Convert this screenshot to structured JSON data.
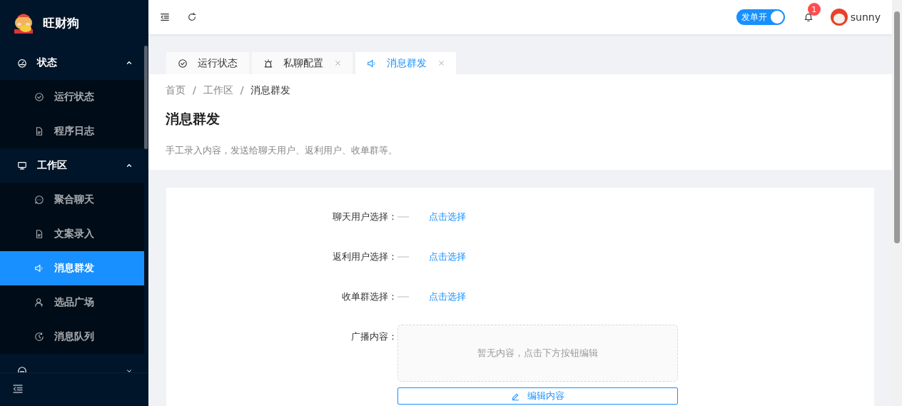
{
  "brand": {
    "name": "旺财狗"
  },
  "sidebar": {
    "groups": [
      {
        "label": "状态",
        "expanded": true,
        "items": [
          {
            "label": "运行状态",
            "selected": false
          },
          {
            "label": "程序日志",
            "selected": false
          }
        ]
      },
      {
        "label": "工作区",
        "expanded": true,
        "items": [
          {
            "label": "聚合聊天",
            "selected": false
          },
          {
            "label": "文案录入",
            "selected": false
          },
          {
            "label": "消息群发",
            "selected": true
          },
          {
            "label": "选品广场",
            "selected": false
          },
          {
            "label": "消息队列",
            "selected": false
          }
        ]
      },
      {
        "expanded": false
      }
    ]
  },
  "header": {
    "switch": {
      "label": "发单开",
      "on": true
    },
    "notifications": {
      "count": "1"
    },
    "user": {
      "name": "sunny"
    }
  },
  "tabs": [
    {
      "label": "运行状态",
      "closable": false,
      "selected": false
    },
    {
      "label": "私聊配置",
      "closable": true,
      "selected": false
    },
    {
      "label": "消息群发",
      "closable": true,
      "selected": true
    }
  ],
  "breadcrumb": {
    "separator": "/",
    "items": [
      "首页",
      "工作区",
      "消息群发"
    ]
  },
  "page": {
    "title": "消息群发",
    "description": "手工录入内容，发送给聊天用户、返利用户、收单群等。"
  },
  "form": {
    "fields": [
      {
        "kind": "picker",
        "label": "聊天用户选择：",
        "link": "点击选择"
      },
      {
        "kind": "picker",
        "label": "返利用户选择：",
        "link": "点击选择"
      },
      {
        "kind": "picker",
        "label": "收单群选择：",
        "link": "点击选择"
      },
      {
        "kind": "content",
        "label": "广播内容：",
        "placeholder": "暂无内容，点击下方按钮编辑",
        "button": "编辑内容"
      }
    ]
  }
}
